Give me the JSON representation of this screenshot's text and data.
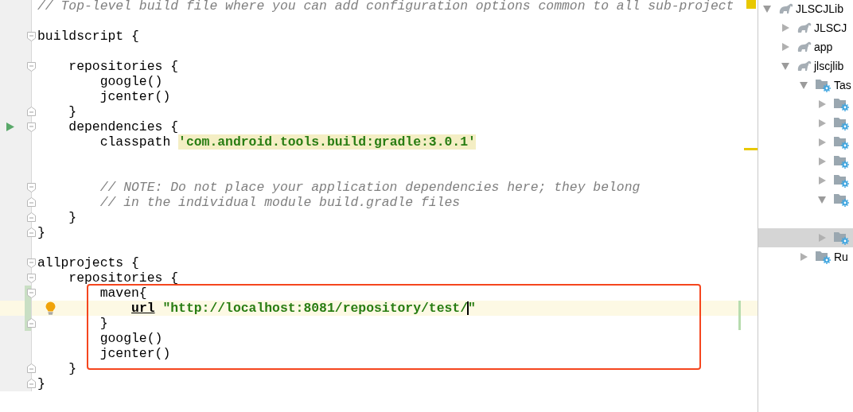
{
  "editor": {
    "lines": [
      {
        "kind": "normal",
        "segments": [
          {
            "kind": "comment",
            "text": "// Top-level build file where you can add configuration options common to all sub-project"
          }
        ]
      },
      {
        "kind": "normal"
      },
      {
        "kind": "normal",
        "segments": [
          {
            "kind": "plain",
            "text": "buildscript {"
          }
        ],
        "gutter": [
          {
            "kind": "fold_start"
          }
        ]
      },
      {
        "kind": "normal"
      },
      {
        "kind": "normal",
        "segments": [
          {
            "kind": "plain",
            "text": "    repositories {"
          }
        ],
        "gutter": [
          {
            "kind": "fold_start"
          }
        ]
      },
      {
        "kind": "normal",
        "segments": [
          {
            "kind": "plain",
            "text": "        google()"
          }
        ]
      },
      {
        "kind": "normal",
        "segments": [
          {
            "kind": "plain",
            "text": "        jcenter()"
          }
        ]
      },
      {
        "kind": "normal",
        "segments": [
          {
            "kind": "plain",
            "text": "    }"
          }
        ],
        "gutter": [
          {
            "kind": "fold_end"
          }
        ]
      },
      {
        "kind": "normal",
        "segments": [
          {
            "kind": "plain",
            "text": "    dependencies {"
          }
        ],
        "gutter": [
          {
            "kind": "run"
          },
          {
            "kind": "fold_start"
          }
        ]
      },
      {
        "kind": "normal",
        "segments": [
          {
            "kind": "plain",
            "text": "        classpath "
          },
          {
            "kind": "string_highlighted",
            "text": "'com.android.tools.build:gradle:3.0.1'"
          }
        ]
      },
      {
        "kind": "normal"
      },
      {
        "kind": "normal"
      },
      {
        "kind": "normal",
        "segments": [
          {
            "kind": "comment",
            "text": "        // NOTE: Do not place your application dependencies here; they belong"
          }
        ],
        "gutter": [
          {
            "kind": "fold_start"
          }
        ]
      },
      {
        "kind": "normal",
        "segments": [
          {
            "kind": "comment",
            "text": "        // in the individual module build.gradle files"
          }
        ],
        "gutter": [
          {
            "kind": "fold_end"
          }
        ]
      },
      {
        "kind": "normal",
        "segments": [
          {
            "kind": "plain",
            "text": "    }"
          }
        ],
        "gutter": [
          {
            "kind": "fold_end"
          }
        ]
      },
      {
        "kind": "normal",
        "segments": [
          {
            "kind": "plain",
            "text": "}"
          }
        ],
        "gutter": [
          {
            "kind": "fold_end"
          }
        ]
      },
      {
        "kind": "normal"
      },
      {
        "kind": "normal",
        "segments": [
          {
            "kind": "plain",
            "text": "allprojects {"
          }
        ],
        "gutter": [
          {
            "kind": "fold_start"
          }
        ]
      },
      {
        "kind": "normal",
        "segments": [
          {
            "kind": "plain",
            "text": "    repositories {"
          }
        ],
        "gutter": [
          {
            "kind": "fold_start"
          }
        ]
      },
      {
        "kind": "annotated_group",
        "lines": [
          {
            "kind": "normal",
            "segments": [
              {
                "kind": "plain",
                "text": "        maven{"
              }
            ],
            "gutter": [
              {
                "kind": "change_marker"
              },
              {
                "kind": "fold_start"
              }
            ]
          },
          {
            "kind": "current",
            "segments": [
              {
                "kind": "keyword",
                "text": "            url"
              },
              {
                "kind": "string",
                "text": " \"http://localhost:8081/repository/test/"
              },
              {
                "kind": "caret"
              },
              {
                "kind": "string",
                "text": "\""
              }
            ],
            "gutter": [
              {
                "kind": "change_marker"
              },
              {
                "kind": "bulb"
              }
            ]
          },
          {
            "kind": "normal",
            "segments": [
              {
                "kind": "plain",
                "text": "        }"
              }
            ],
            "gutter": [
              {
                "kind": "change_marker"
              },
              {
                "kind": "fold_end"
              }
            ]
          },
          {
            "kind": "normal",
            "segments": [
              {
                "kind": "plain",
                "text": "        google()"
              }
            ]
          },
          {
            "kind": "normal",
            "segments": [
              {
                "kind": "plain",
                "text": "        jcenter()"
              }
            ]
          }
        ]
      },
      {
        "kind": "normal",
        "segments": [
          {
            "kind": "plain",
            "text": "    }"
          }
        ],
        "gutter": [
          {
            "kind": "fold_end"
          }
        ]
      },
      {
        "kind": "normal",
        "segments": [
          {
            "kind": "plain",
            "text": "}"
          }
        ],
        "gutter": [
          {
            "kind": "fold_end"
          }
        ]
      }
    ]
  },
  "gradle_tree": {
    "items": [
      {
        "label": "JLSCJLib",
        "kind": "project",
        "expanded": true,
        "selected": false,
        "children": [
          {
            "label": "JLSCJ",
            "kind": "project",
            "expanded": false,
            "selected": false
          },
          {
            "label": "app",
            "kind": "project",
            "expanded": false,
            "selected": false
          },
          {
            "label": "jlscjlib",
            "kind": "project",
            "expanded": true,
            "selected": false,
            "children": [
              {
                "label": "Tas",
                "kind": "task_group",
                "expanded": true,
                "selected": false,
                "children": [
                  {
                    "kind": "task_group",
                    "expanded": false,
                    "selected": false
                  },
                  {
                    "kind": "task_group",
                    "expanded": false,
                    "selected": false
                  },
                  {
                    "kind": "task_group",
                    "expanded": false,
                    "selected": false
                  },
                  {
                    "kind": "task_group",
                    "expanded": false,
                    "selected": false
                  },
                  {
                    "kind": "task_group",
                    "expanded": false,
                    "selected": false
                  },
                  {
                    "kind": "task_group",
                    "expanded": true,
                    "selected": false,
                    "children": [
                      {
                        "kind": "offscreen"
                      }
                    ]
                  },
                  {
                    "kind": "task_group",
                    "expanded": false,
                    "selected": true
                  }
                ]
              },
              {
                "label": "Ru",
                "kind": "task_group",
                "expanded": false,
                "selected": false
              }
            ]
          }
        ]
      }
    ]
  }
}
